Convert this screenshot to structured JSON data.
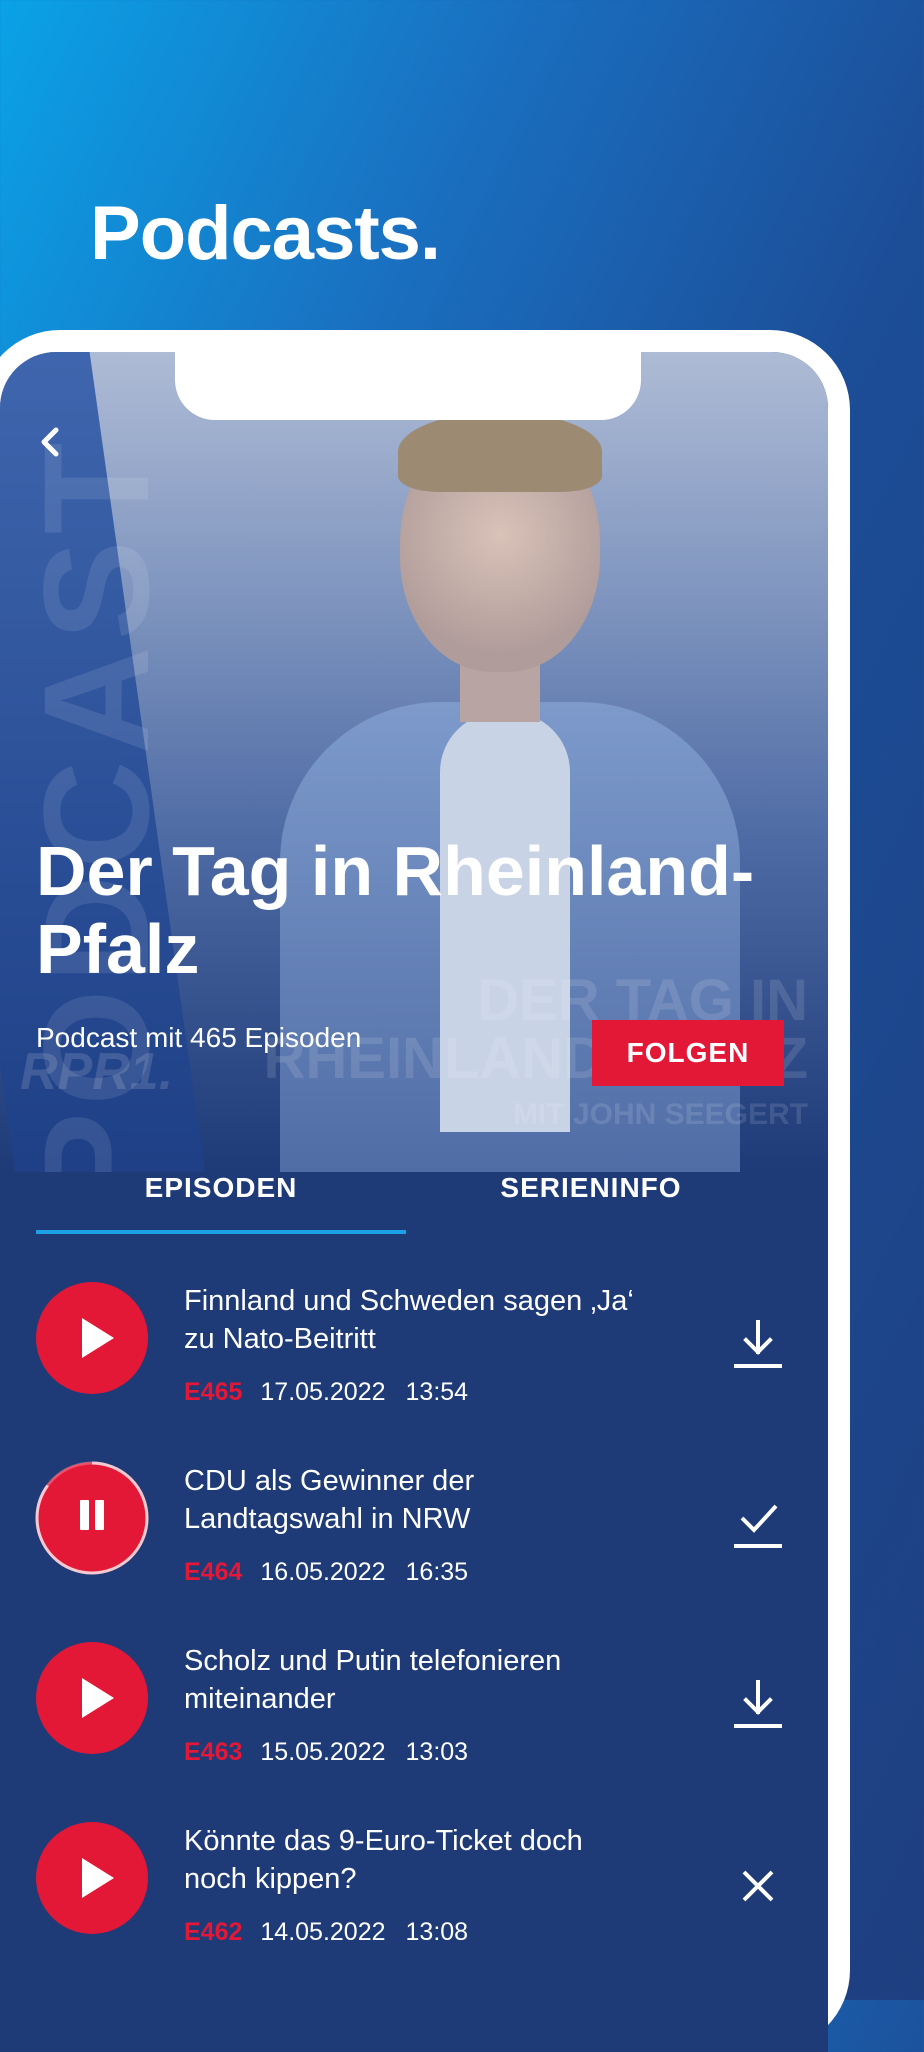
{
  "promo": {
    "title": "Podcasts."
  },
  "hero": {
    "watermark_side": "PODCAST",
    "watermark_logo": "RPR1.",
    "watermark_lines": [
      "DER TAG IN",
      "RHEINLAND-PFALZ",
      "MIT JOHN SEEGERT"
    ]
  },
  "show": {
    "title": "Der Tag in Rheinland-Pfalz",
    "episode_count": "Podcast mit 465 Episoden",
    "follow_label": "FOLGEN"
  },
  "tabs": [
    {
      "label": "EPISODEN",
      "active": true
    },
    {
      "label": "SERIENINFO",
      "active": false
    }
  ],
  "episodes": [
    {
      "title": "Finnland und Schweden sagen ‚Ja‘ zu Nato-Beitritt",
      "number": "E465",
      "date": "17.05.2022",
      "time": "13:54",
      "state": "play",
      "action": "download-icon"
    },
    {
      "title": "CDU als Gewinner der Landtagswahl in NRW",
      "number": "E464",
      "date": "16.05.2022",
      "time": "16:35",
      "state": "pause",
      "progress": 0.85,
      "action": "downloaded-check-icon"
    },
    {
      "title": "Scholz und Putin telefonieren miteinander",
      "number": "E463",
      "date": "15.05.2022",
      "time": "13:03",
      "state": "play",
      "action": "download-icon"
    },
    {
      "title": "Könnte das 9-Euro-Ticket doch noch kippen?",
      "number": "E462",
      "date": "14.05.2022",
      "time": "13:08",
      "state": "play",
      "action": "close-icon"
    }
  ],
  "colors": {
    "accent": "#e31837",
    "tab_indicator": "#1ea0e6",
    "background": "#1e3a77"
  }
}
